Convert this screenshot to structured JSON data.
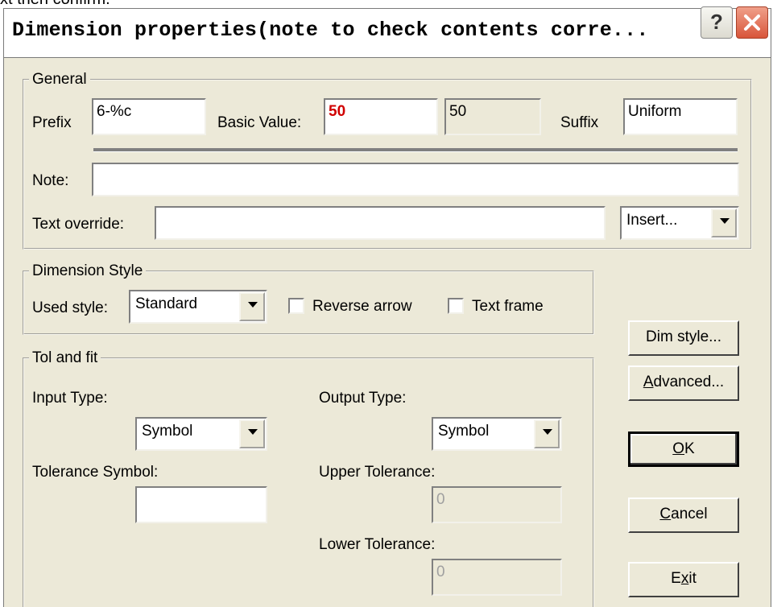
{
  "background_text": "xt then confirm.",
  "window": {
    "title": "Dimension properties(note to check contents corre...",
    "help_label": "?"
  },
  "general": {
    "legend": "General",
    "prefix_label": "Prefix",
    "prefix_value": "6-%c",
    "basic_value_label": "Basic Value:",
    "basic_value": "50",
    "basic_value_readonly": "50",
    "suffix_label": "Suffix",
    "suffix_value": "Uniform",
    "note_label": "Note:",
    "note_value": "",
    "text_override_label": "Text override:",
    "text_override_value": "",
    "insert_label": "Insert..."
  },
  "dimension_style": {
    "legend": "Dimension Style",
    "used_style_label": "Used style:",
    "used_style_value": "Standard",
    "reverse_arrow_label": "Reverse arrow",
    "reverse_arrow_checked": false,
    "text_frame_label": "Text frame",
    "text_frame_checked": false
  },
  "tol_fit": {
    "legend": "Tol and fit",
    "input_type_label": "Input Type:",
    "input_type_value": "Symbol",
    "output_type_label": "Output Type:",
    "output_type_value": "Symbol",
    "tolerance_symbol_label": "Tolerance Symbol:",
    "tolerance_symbol_value": "",
    "upper_tolerance_label": "Upper Tolerance:",
    "upper_tolerance_value": "0",
    "lower_tolerance_label": "Lower Tolerance:",
    "lower_tolerance_value": "0"
  },
  "buttons": {
    "dim_style": "Dim style...",
    "advanced_rest": "dvanced...",
    "advanced_mnemonic": "A",
    "ok_rest": "K",
    "ok_mnemonic": "O",
    "cancel_rest": "ancel",
    "cancel_mnemonic": "C",
    "exit_rest": "it",
    "exit_pre": "E",
    "exit_mnemonic": "x"
  },
  "colors": {
    "dialog_bg": "#ece9d8",
    "basic_value_text": "#d00000",
    "close_button": "#d8553a"
  }
}
